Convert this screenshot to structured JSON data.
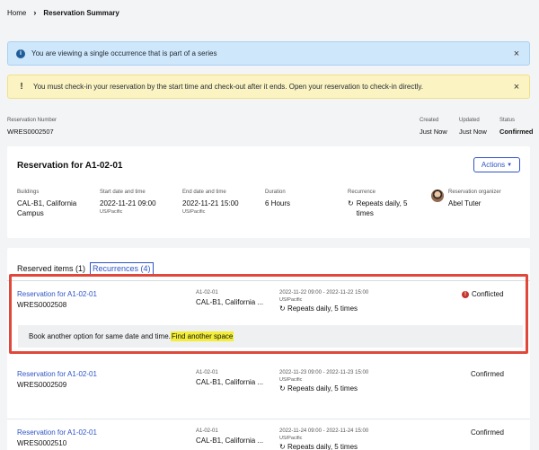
{
  "breadcrumb": {
    "home": "Home",
    "separator": "›",
    "current": "Reservation Summary"
  },
  "banners": {
    "info": {
      "icon": "i",
      "text": "You are viewing a single occurrence that is part of a series",
      "close": "×"
    },
    "warning": {
      "icon": "!",
      "text": "You must check-in your reservation by the start time and check-out after it ends. Open your reservation to check-in directly.",
      "close": "×"
    }
  },
  "meta": {
    "reservation_number_label": "Reservation Number",
    "reservation_number": "WRES0002507",
    "created_label": "Created",
    "created": "Just Now",
    "updated_label": "Updated",
    "updated": "Just Now",
    "status_label": "Status",
    "status": "Confirmed"
  },
  "summary": {
    "title": "Reservation for A1-02-01",
    "actions_label": "Actions",
    "buildings_label": "Buildings",
    "buildings_value": "CAL-B1, California Campus",
    "start_label": "Start date and time",
    "start_value": "2022-11-21 09:00",
    "start_tz": "US/Pacific",
    "end_label": "End date and time",
    "end_value": "2022-11-21 15:00",
    "end_tz": "US/Pacific",
    "duration_label": "Duration",
    "duration_value": "6 Hours",
    "recurrence_label": "Recurrence",
    "recurrence_value": "Repeats daily, 5 times",
    "organizer_label": "Reservation organizer",
    "organizer_value": "Abel Tuter"
  },
  "items": {
    "tab_reserved": "Reserved items (1)",
    "tab_recurrences": "Recurrences (4)",
    "rows": [
      {
        "link": "Reservation for A1-02-01",
        "number": "WRES0002508",
        "code": "A1-02-01",
        "place": "CAL-B1, California ...",
        "datetime": "2022-11-22 09:00 - 2022-11-22 15:00",
        "tz": "US/Pacific",
        "repeat": "Repeats daily, 5 times",
        "status": "Conflicted"
      },
      {
        "link": "Reservation for A1-02-01",
        "number": "WRES0002509",
        "code": "A1-02-01",
        "place": "CAL-B1, California ...",
        "datetime": "2022-11-23 09:00 - 2022-11-23 15:00",
        "tz": "US/Pacific",
        "repeat": "Repeats daily, 5 times",
        "status": "Confirmed"
      },
      {
        "link": "Reservation for A1-02-01",
        "number": "WRES0002510",
        "code": "A1-02-01",
        "place": "CAL-B1, California ...",
        "datetime": "2022-11-24 09:00 - 2022-11-24 15:00",
        "tz": "US/Pacific",
        "repeat": "Repeats daily, 5 times",
        "status": "Confirmed"
      }
    ],
    "alt_text": "Book another option for same date and time.",
    "alt_link": "Find another space"
  },
  "colors": {
    "link": "#2f54c7",
    "conflict": "#c6362c",
    "highlight": "#e0483c"
  }
}
